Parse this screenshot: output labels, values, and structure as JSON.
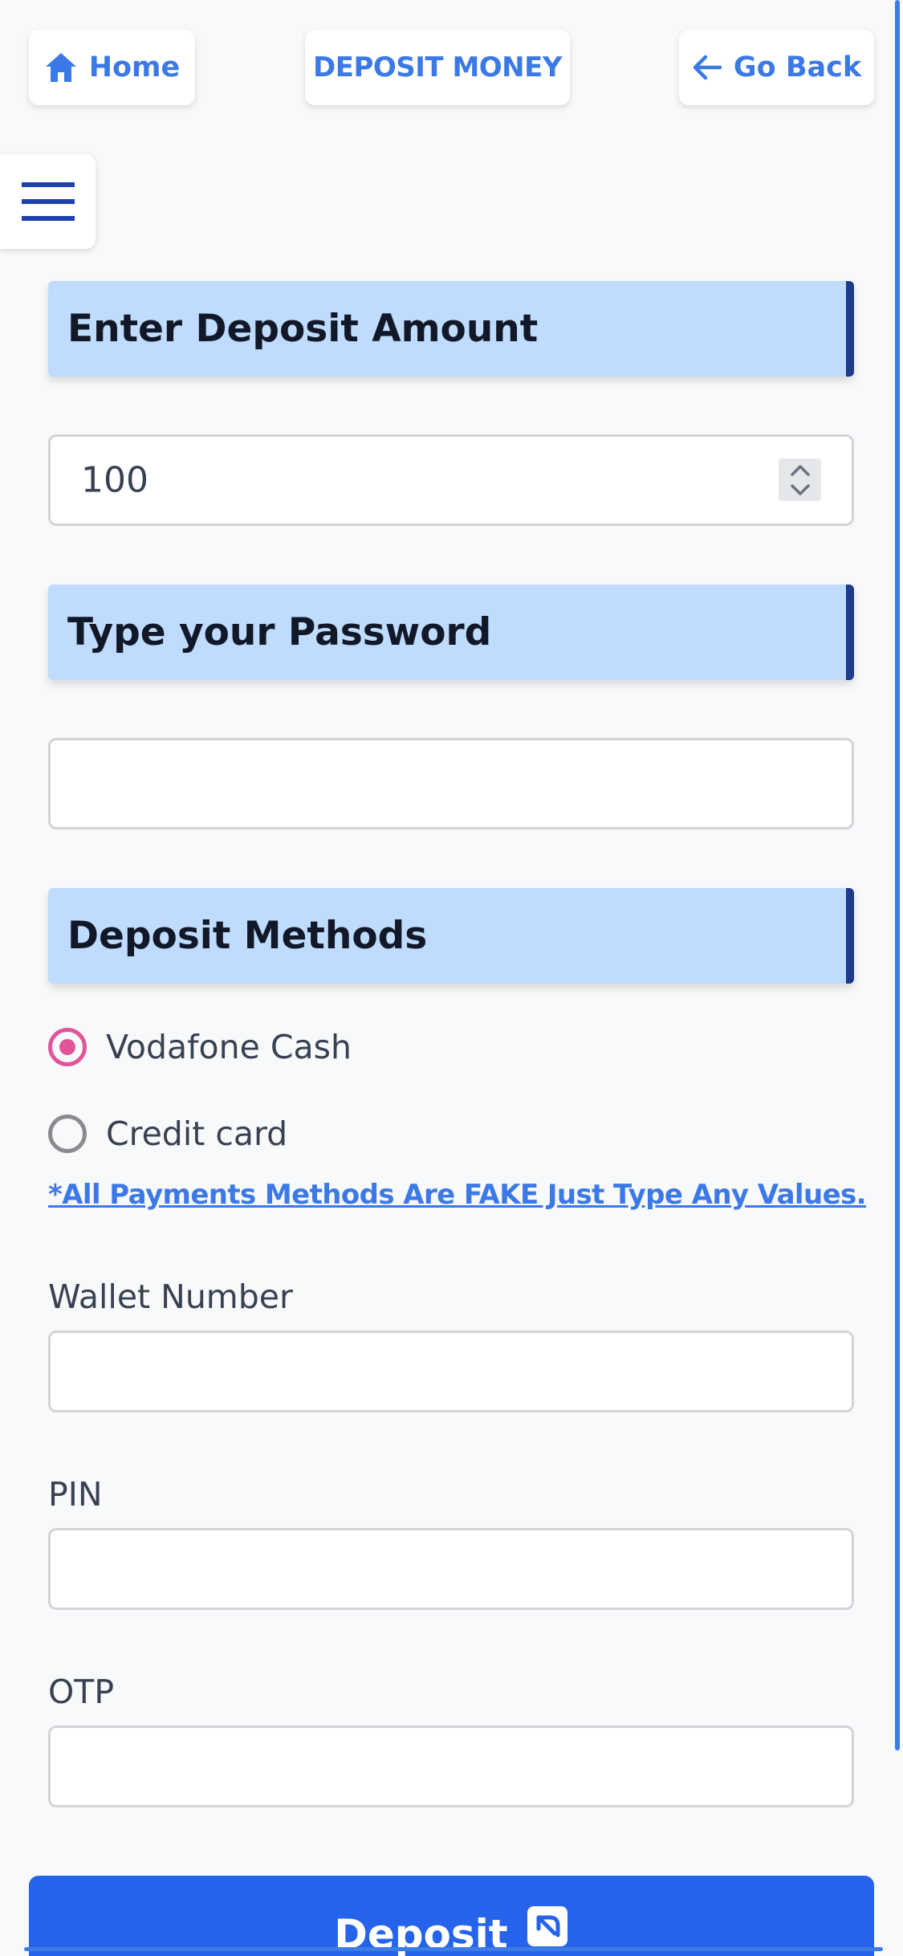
{
  "nav": {
    "home_label": "Home",
    "title": "DEPOSIT MONEY",
    "back_label": "Go Back"
  },
  "sections": {
    "amount_header": "Enter Deposit Amount",
    "password_header": "Type your Password",
    "methods_header": "Deposit Methods"
  },
  "amount": {
    "value": "100"
  },
  "password": {
    "value": ""
  },
  "methods": [
    {
      "label": "Vodafone Cash",
      "selected": true
    },
    {
      "label": "Credit card",
      "selected": false
    }
  ],
  "note": "*All Payments Methods Are FAKE Just Type Any Values.",
  "fields": {
    "wallet_label": "Wallet Number",
    "pin_label": "PIN",
    "otp_label": "OTP"
  },
  "submit_label": "Deposit",
  "colors": {
    "accent": "#2563eb",
    "link": "#3b7ae6",
    "header_bg": "#bfdbfe",
    "header_border": "#1e3a8a",
    "radio": "#e0559a"
  }
}
